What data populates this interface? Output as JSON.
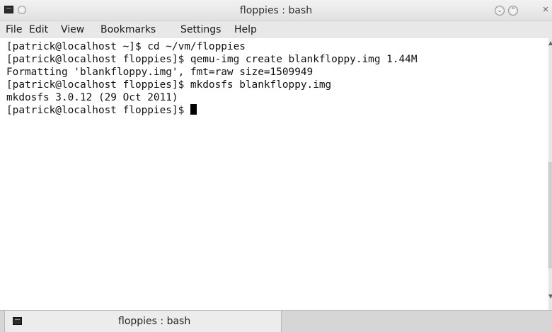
{
  "window": {
    "title": "floppies : bash"
  },
  "menubar": {
    "items": [
      "File",
      "Edit",
      "View",
      "Bookmarks",
      "Settings",
      "Help"
    ]
  },
  "terminal": {
    "lines": [
      "[patrick@localhost ~]$ cd ~/vm/floppies",
      "[patrick@localhost floppies]$ qemu-img create blankfloppy.img 1.44M",
      "Formatting 'blankfloppy.img', fmt=raw size=1509949",
      "[patrick@localhost floppies]$ mkdosfs blankfloppy.img",
      "mkdosfs 3.0.12 (29 Oct 2011)",
      "[patrick@localhost floppies]$ "
    ]
  },
  "tabs": [
    {
      "label": "floppies : bash"
    }
  ],
  "icons": {
    "app": "terminal-icon",
    "menu": "window-menu-icon",
    "minimize": "minimize-icon",
    "maximize": "maximize-icon",
    "close": "close-icon",
    "tab": "terminal-icon"
  }
}
